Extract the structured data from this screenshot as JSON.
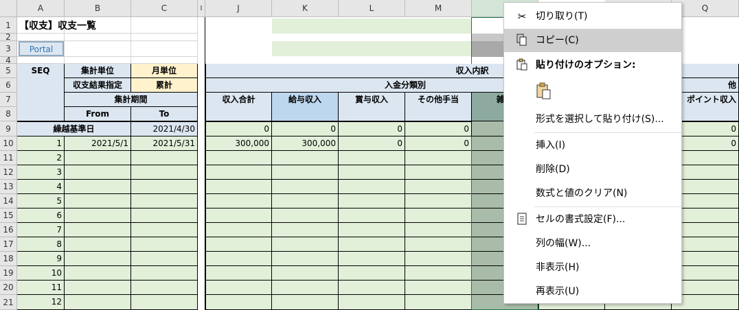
{
  "columns": [
    "A",
    "B",
    "C",
    "I",
    "J",
    "K",
    "L",
    "M",
    "Q"
  ],
  "rows": [
    "1",
    "2",
    "3",
    "4",
    "5",
    "6",
    "7",
    "8",
    "9",
    "10",
    "11",
    "12",
    "13",
    "14",
    "15",
    "16",
    "17",
    "18",
    "19",
    "20",
    "21"
  ],
  "title": "【収支】収支一覧",
  "portal_button": "Portal",
  "header": {
    "seq": "SEQ",
    "agg_unit": "集計単位",
    "agg_unit_value": "月単位",
    "result_spec": "収支結果指定",
    "result_spec_value": "累計",
    "agg_period": "集計期間",
    "from": "From",
    "to": "To",
    "income_detail": "収入内訳",
    "deposit_cat": "入金分類別",
    "income_total": "収入合計",
    "salary_income": "給与収入",
    "bonus_income": "賞与収入",
    "other_allowance": "その他手当",
    "misc_partial": "雑収",
    "point_income_partial": "ポイント収入",
    "group_partial": "他"
  },
  "carry_row": {
    "label": "繰越基準日",
    "date": "2021/4/30",
    "j": "0",
    "k": "0",
    "l": "0",
    "m": "0",
    "q": "0"
  },
  "data_rows": [
    {
      "seq": "1",
      "from": "2021/5/1",
      "to": "2021/5/31",
      "j": "300,000",
      "k": "300,000",
      "l": "0",
      "m": "0",
      "q": "0"
    },
    {
      "seq": "2"
    },
    {
      "seq": "3"
    },
    {
      "seq": "4"
    },
    {
      "seq": "5"
    },
    {
      "seq": "6"
    },
    {
      "seq": "7"
    },
    {
      "seq": "8"
    },
    {
      "seq": "9"
    },
    {
      "seq": "10"
    },
    {
      "seq": "11"
    },
    {
      "seq": "12"
    }
  ],
  "context_menu": {
    "cut": "切り取り(T)",
    "copy": "コピー(C)",
    "paste_options": "貼り付けのオプション:",
    "paste_special": "形式を選択して貼り付け(S)...",
    "insert": "挿入(I)",
    "delete": "削除(D)",
    "clear": "数式と値のクリア(N)",
    "format_cells": "セルの書式設定(F)...",
    "col_width": "列の幅(W)...",
    "hide": "非表示(H)",
    "unhide": "再表示(U)"
  }
}
